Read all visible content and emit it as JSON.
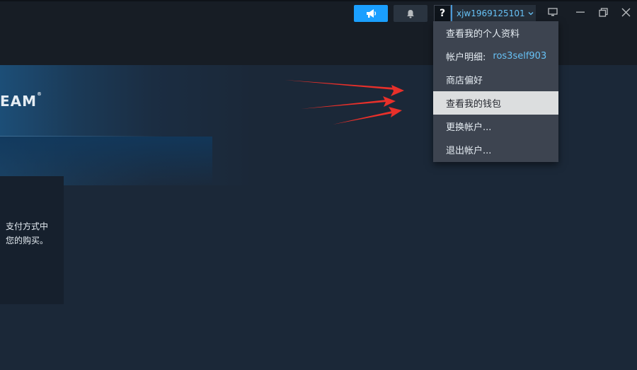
{
  "header": {
    "help_label": "?",
    "account_name": "xjw1969125101"
  },
  "icons": {
    "announce": "megaphone-icon",
    "notifications": "bell-icon",
    "account_dropdown": "chevron-down-icon",
    "big_picture": "monitor-icon",
    "minimize": "minimize-icon",
    "restore": "restore-icon",
    "close": "close-icon"
  },
  "colors": {
    "accent": "#1a9fff",
    "link": "#67c1f5",
    "menu_bg": "#3d4450",
    "menu_active_bg": "#dcdedf",
    "annotation_arrow": "#e8302a"
  },
  "banner": {
    "logo_text": "EAM",
    "logo_mark": "®"
  },
  "panel": {
    "line1": "支付方式中",
    "line2": "您的购买。"
  },
  "dropdown": {
    "items": [
      {
        "label": "查看我的个人资料"
      },
      {
        "label": "帐户明细:",
        "sub": "ros3self903"
      },
      {
        "label": "商店偏好"
      },
      {
        "label": "查看我的钱包"
      },
      {
        "label": "更换帐户..."
      },
      {
        "label": "退出帐户..."
      }
    ]
  }
}
